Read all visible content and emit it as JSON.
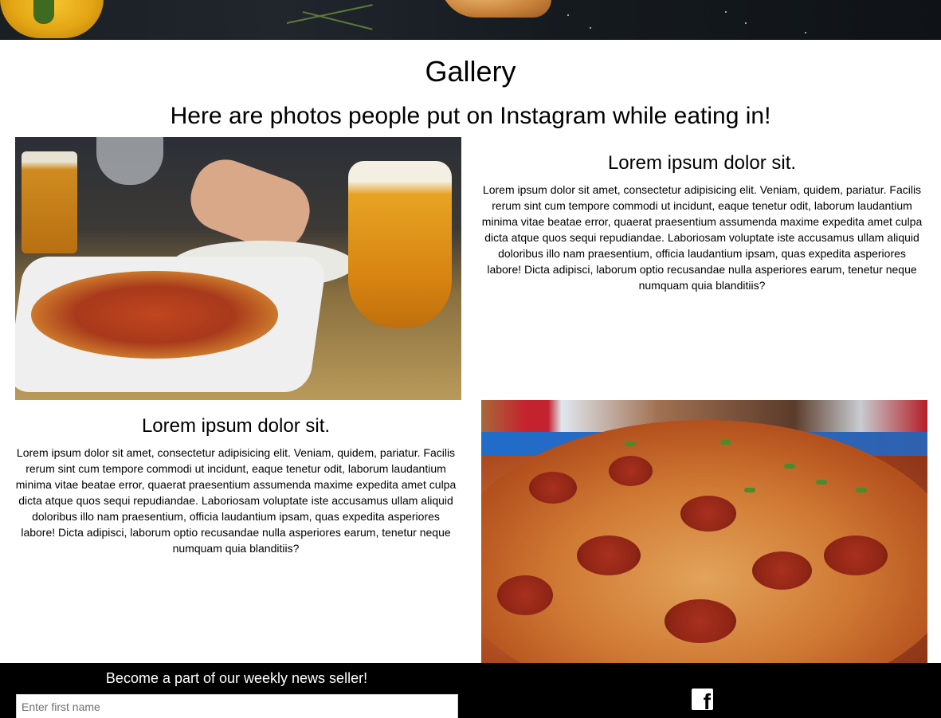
{
  "hero": {
    "icons": [
      "pepper-image",
      "herb-image",
      "pizza-slice-image"
    ]
  },
  "gallery": {
    "title": "Gallery",
    "subtitle": "Here are photos people put on Instagram while eating in!"
  },
  "cards": [
    {
      "heading": "Lorem ipsum dolor sit.",
      "body": "Lorem ipsum dolor sit amet, consectetur adipisicing elit. Veniam, quidem, pariatur. Facilis rerum sint cum tempore commodi ut incidunt, eaque tenetur odit, laborum laudantium minima vitae beatae error, quaerat praesentium assumenda maxime expedita amet culpa dicta atque quos sequi repudiandae. Laboriosam voluptate iste accusamus ullam aliquid doloribus illo nam praesentium, officia laudantium ipsam, quas expedita asperiores labore! Dicta adipisci, laborum optio recusandae nulla asperiores earum, tenetur neque numquam quia blanditiis?"
    },
    {
      "heading": "Lorem ipsum dolor sit.",
      "body": "Lorem ipsum dolor sit amet, consectetur adipisicing elit. Veniam, quidem, pariatur. Facilis rerum sint cum tempore commodi ut incidunt, eaque tenetur odit, laborum laudantium minima vitae beatae error, quaerat praesentium assumenda maxime expedita amet culpa dicta atque quos sequi repudiandae. Laboriosam voluptate iste accusamus ullam aliquid doloribus illo nam praesentium, officia laudantium ipsam, quas expedita asperiores labore! Dicta adipisci, laborum optio recusandae nulla asperiores earum, tenetur neque numquam quia blanditiis?"
    }
  ],
  "footer": {
    "newsletter_title": "Become a part of our weekly news seller!",
    "first_name_placeholder": "Enter first name",
    "first_name_value": "",
    "social_icon": "facebook-icon",
    "facebook_glyph": "f"
  },
  "colors": {
    "footer_bg": "#000000",
    "footer_text": "#ffffff"
  }
}
